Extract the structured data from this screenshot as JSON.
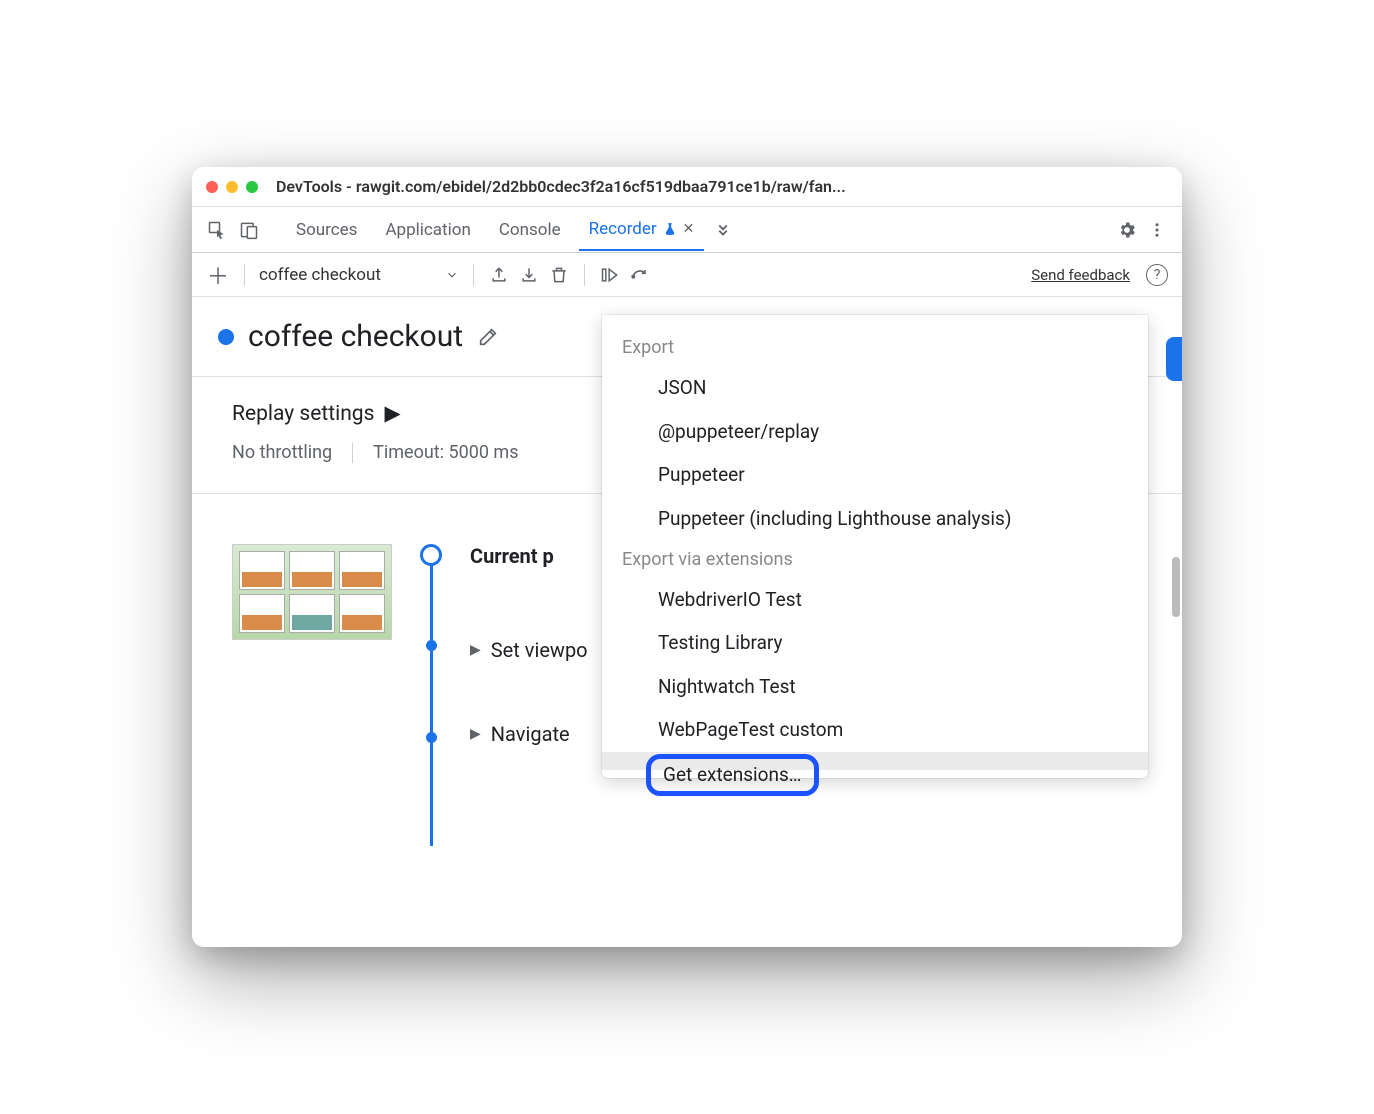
{
  "window": {
    "title": "DevTools - rawgit.com/ebidel/2d2bb0cdec3f2a16cf519dbaa791ce1b/raw/fan..."
  },
  "tabs": {
    "items": [
      "Sources",
      "Application",
      "Console",
      "Recorder"
    ],
    "active_index": 3
  },
  "toolbar": {
    "recording_name": "coffee checkout",
    "feedback_label": "Send feedback"
  },
  "recording": {
    "title": "coffee checkout"
  },
  "replay": {
    "label": "Replay settings",
    "throttling": "No throttling",
    "timeout": "Timeout: 5000 ms"
  },
  "steps": {
    "current": "Current p",
    "items": [
      "Set viewpo",
      "Navigate"
    ]
  },
  "popover": {
    "section1": "Export",
    "items1": [
      "JSON",
      "@puppeteer/replay",
      "Puppeteer",
      "Puppeteer (including Lighthouse analysis)"
    ],
    "section2": "Export via extensions",
    "items2": [
      "WebdriverIO Test",
      "Testing Library",
      "Nightwatch Test",
      "WebPageTest custom",
      "Get extensions…"
    ]
  }
}
